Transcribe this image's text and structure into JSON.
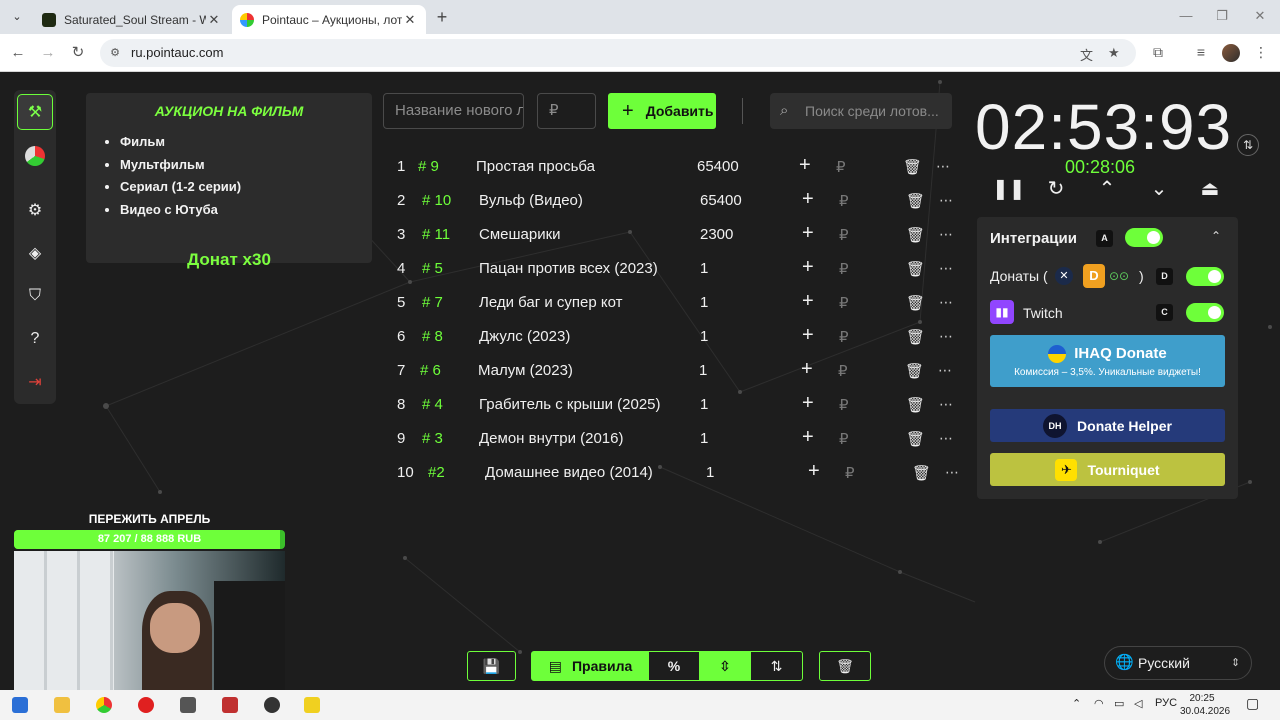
{
  "browser": {
    "tabs": [
      {
        "title": "Saturated_Soul Stream - Watch",
        "close": "✕"
      },
      {
        "title": "Pointauc – Аукционы, лотереи",
        "close": "✕"
      }
    ],
    "new_tab": "+",
    "url": "ru.pointauc.com"
  },
  "auction": {
    "title": "АУКЦИОН НА ФИЛЬМ",
    "items": [
      "Фильм",
      "Мультфильм",
      "Сериал (1-2 серии)",
      "Видео с Ютуба"
    ],
    "donate_multiplier": "Донат х30"
  },
  "lot_form": {
    "name_placeholder": "Название нового лота",
    "amount_placeholder": "₽",
    "add_label": "Добавить",
    "search_placeholder": "Поиск среди лотов..."
  },
  "lots": [
    {
      "n": "1",
      "id": "# 9",
      "name": "Простая просьба",
      "amount": "65400"
    },
    {
      "n": "2",
      "id": "# 10",
      "name": "Вульф  (Видео)",
      "amount": "65400"
    },
    {
      "n": "3",
      "id": "# 11",
      "name": "Смешарики",
      "amount": "2300"
    },
    {
      "n": "4",
      "id": "# 5",
      "name": "Пацан против всех (2023)",
      "amount": "1"
    },
    {
      "n": "5",
      "id": "# 7",
      "name": "Леди баг и супер кот",
      "amount": "1"
    },
    {
      "n": "6",
      "id": "# 8",
      "name": "Джулс (2023)",
      "amount": "1"
    },
    {
      "n": "7",
      "id": "# 6",
      "name": "Малум (2023)",
      "amount": "1"
    },
    {
      "n": "8",
      "id": "# 4",
      "name": "Грабитель с крыши (2025)",
      "amount": "1"
    },
    {
      "n": "9",
      "id": "# 3",
      "name": "Демон внутри (2016)",
      "amount": "1"
    },
    {
      "n": "10",
      "id": "#2",
      "name": "Домашнее видео (2014)",
      "amount": "1"
    }
  ],
  "lot_row_symbols": {
    "plus": "+",
    "currency": "₽",
    "trash": "🗑",
    "more": "⋯"
  },
  "timer": {
    "main": "02:53:93",
    "sub": "00:28:06"
  },
  "integrations": {
    "title": "Интеграции",
    "title_key": "A",
    "donations_label": "Донаты (",
    "donations_close": ")",
    "donations_key": "D",
    "twitch_label": "Twitch",
    "twitch_key": "C",
    "ihaq_title": "IHAQ Donate",
    "ihaq_sub": "Комиссия – 3,5%. Уникальные виджеты!",
    "donate_helper_label": "Donate Helper",
    "donate_helper_logo": "DH",
    "tourniquet_label": "Tourniquet"
  },
  "bottom_toolbar": {
    "rules_label": "Правила"
  },
  "language": {
    "selected": "Русский"
  },
  "stream_overlay": {
    "goal_title": "ПЕРЕЖИТЬ АПРЕЛЬ",
    "goal_progress": "87 207 / 88 888 RUB",
    "goal_fraction": 0.981
  },
  "taskbar": {
    "lang": "РУС",
    "time": "20:25",
    "date": "30.04.2026"
  },
  "colors": {
    "accent": "#6eff3a",
    "ihaq": "#3f9ecb",
    "donate_helper": "#253a7a",
    "tourniquet": "#bcc240",
    "twitch": "#9146ff"
  },
  "icons": [
    "gavel-icon",
    "pie-chart-icon",
    "gear-icon",
    "layers-icon",
    "shield-icon",
    "help-icon",
    "logout-icon",
    "save-icon",
    "percent-icon",
    "compress-icon",
    "sort-icon",
    "delete-all-icon",
    "globe-icon",
    "search-icon",
    "pause-icon",
    "restart-icon",
    "chevron-up-icon",
    "chevron-down-icon",
    "skip-up-icon",
    "swap-icon"
  ]
}
